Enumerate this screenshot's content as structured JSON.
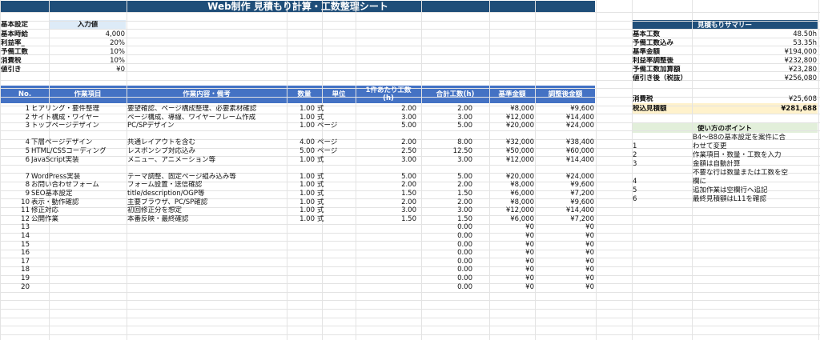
{
  "title": "Web制作 見積もり計算・工数整理シート",
  "settings": {
    "header_label": "基本設定",
    "header_value": "入力値",
    "rows": [
      {
        "label": "基本時給",
        "value": "4,000"
      },
      {
        "label": "利益率_",
        "value": "20%"
      },
      {
        "label": "予備工数",
        "value": "10%"
      },
      {
        "label": "消費税",
        "value": "10%"
      },
      {
        "label": "値引き",
        "value": "¥0"
      }
    ]
  },
  "table": {
    "headers": [
      "No.",
      "作業項目",
      "作業内容・備考",
      "数量",
      "単位",
      "1件あたり工数",
      "(h)",
      "合計工数(h)",
      "基準金額",
      "調整後金額"
    ],
    "rows": [
      {
        "no": "1",
        "item": "ヒアリング・要件整理",
        "note": "要望確認、ページ構成整理、必要素材確認",
        "qty": "1.00",
        "unit": "式",
        "per": "2.00",
        "total": "2.00",
        "base": "¥8,000",
        "adj": "¥9,600"
      },
      {
        "no": "2",
        "item": "サイト構成・ワイヤー",
        "note": "ページ構成、導線、ワイヤーフレーム作成",
        "qty": "1.00",
        "unit": "式",
        "per": "3.00",
        "total": "3.00",
        "base": "¥12,000",
        "adj": "¥14,400"
      },
      {
        "no": "3",
        "item": "トップページデザイン",
        "note": "PC/SPデザイン",
        "qty": "1.00",
        "unit": "ページ",
        "per": "5.00",
        "total": "5.00",
        "base": "¥20,000",
        "adj": "¥24,000"
      },
      {
        "no": "4",
        "item": "下層ページデザイン",
        "note": "共通レイアウトを含む",
        "qty": "4.00",
        "unit": "ページ",
        "per": "2.00",
        "total": "8.00",
        "base": "¥32,000",
        "adj": "¥38,400"
      },
      {
        "no": "5",
        "item": "HTML/CSSコーディング",
        "note": "レスポンシブ対応込み",
        "qty": "5.00",
        "unit": "ページ",
        "per": "2.50",
        "total": "12.50",
        "base": "¥50,000",
        "adj": "¥60,000"
      },
      {
        "no": "6",
        "item": "JavaScript実装",
        "note": "メニュー、アニメーション等",
        "qty": "1.00",
        "unit": "式",
        "per": "3.00",
        "total": "3.00",
        "base": "¥12,000",
        "adj": "¥14,400"
      },
      {
        "no": "7",
        "item": "WordPress実装",
        "note": "テーマ調整、固定ページ組み込み等",
        "qty": "1.00",
        "unit": "式",
        "per": "5.00",
        "total": "5.00",
        "base": "¥20,000",
        "adj": "¥24,000"
      },
      {
        "no": "8",
        "item": "お問い合わせフォーム",
        "note": "フォーム設置・送信確認",
        "qty": "1.00",
        "unit": "式",
        "per": "2.00",
        "total": "2.00",
        "base": "¥8,000",
        "adj": "¥9,600"
      },
      {
        "no": "9",
        "item": "SEO基本設定",
        "note": "title/description/OGP等",
        "qty": "1.00",
        "unit": "式",
        "per": "1.50",
        "total": "1.50",
        "base": "¥6,000",
        "adj": "¥7,200"
      },
      {
        "no": "10",
        "item": "表示・動作確認",
        "note": "主要ブラウザ、PC/SP確認",
        "qty": "1.00",
        "unit": "式",
        "per": "2.00",
        "total": "2.00",
        "base": "¥8,000",
        "adj": "¥9,600"
      },
      {
        "no": "11",
        "item": "修正対応",
        "note": "初回修正分を想定",
        "qty": "1.00",
        "unit": "式",
        "per": "3.00",
        "total": "3.00",
        "base": "¥12,000",
        "adj": "¥14,400"
      },
      {
        "no": "12",
        "item": "公開作業",
        "note": "本番反映・最終確認",
        "qty": "1.00",
        "unit": "式",
        "per": "1.50",
        "total": "1.50",
        "base": "¥6,000",
        "adj": "¥7,200"
      },
      {
        "no": "13",
        "item": "",
        "note": "",
        "qty": "",
        "unit": "",
        "per": "",
        "total": "0.00",
        "base": "¥0",
        "adj": "¥0"
      },
      {
        "no": "14",
        "item": "",
        "note": "",
        "qty": "",
        "unit": "",
        "per": "",
        "total": "0.00",
        "base": "¥0",
        "adj": "¥0"
      },
      {
        "no": "15",
        "item": "",
        "note": "",
        "qty": "",
        "unit": "",
        "per": "",
        "total": "0.00",
        "base": "¥0",
        "adj": "¥0"
      },
      {
        "no": "16",
        "item": "",
        "note": "",
        "qty": "",
        "unit": "",
        "per": "",
        "total": "0.00",
        "base": "¥0",
        "adj": "¥0"
      },
      {
        "no": "17",
        "item": "",
        "note": "",
        "qty": "",
        "unit": "",
        "per": "",
        "total": "0.00",
        "base": "¥0",
        "adj": "¥0"
      },
      {
        "no": "18",
        "item": "",
        "note": "",
        "qty": "",
        "unit": "",
        "per": "",
        "total": "0.00",
        "base": "¥0",
        "adj": "¥0"
      },
      {
        "no": "19",
        "item": "",
        "note": "",
        "qty": "",
        "unit": "",
        "per": "",
        "total": "0.00",
        "base": "¥0",
        "adj": "¥0"
      },
      {
        "no": "20",
        "item": "",
        "note": "",
        "qty": "",
        "unit": "",
        "per": "",
        "total": "0.00",
        "base": "¥0",
        "adj": "¥0"
      }
    ]
  },
  "summary": {
    "title": "見積もりサマリー",
    "rows": [
      {
        "label": "基本工数",
        "value": "48.50h"
      },
      {
        "label": "予備工数込み",
        "value": "53.35h"
      },
      {
        "label": "基準金額",
        "value": "¥194,000"
      },
      {
        "label": "利益率調整後",
        "value": "¥232,800"
      },
      {
        "label": "予備工数加算額",
        "value": "¥23,280"
      },
      {
        "label": "値引き後（税抜）",
        "value": "¥256,080"
      }
    ],
    "tax_label": "消費税",
    "tax_value": "¥25,608",
    "total_label": "税込見積額",
    "total_value": "¥281,688"
  },
  "tips": {
    "title": "使い方のポイント",
    "items": [
      {
        "no": "",
        "lines": [
          "B4〜B8の基本設定を案件に合"
        ]
      },
      {
        "no": "1",
        "lines": [
          "わせて変更"
        ]
      },
      {
        "no": "2",
        "lines": [
          "作業項目・数量・工数を入力"
        ]
      },
      {
        "no": "3",
        "lines": [
          "金額は自動計算"
        ]
      },
      {
        "no": "",
        "lines": [
          "不要な行は数量または工数を空"
        ]
      },
      {
        "no": "4",
        "lines": [
          "欄に"
        ]
      },
      {
        "no": "5",
        "lines": [
          "追加作業は空欄行へ追記"
        ]
      },
      {
        "no": "6",
        "lines": [
          "最終見積額はL11を確認"
        ]
      }
    ]
  },
  "colors": {
    "title_bg": "#1f4e79",
    "header_bg": "#4472c4",
    "input_header_bg": "#ddebf7",
    "total_bg": "#fff2cc",
    "tips_bg": "#e2efda"
  }
}
